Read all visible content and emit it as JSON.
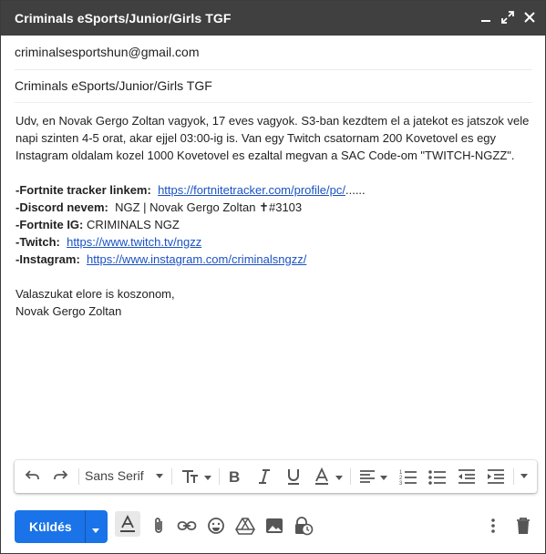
{
  "window": {
    "title": "Criminals eSports/Junior/Girls TGF"
  },
  "compose": {
    "to": "criminalsesportshun@gmail.com",
    "subject": "Criminals eSports/Junior/Girls TGF",
    "body": {
      "intro": "Udv, en Novak Gergo Zoltan vagyok, 17 eves vagyok. S3-ban kezdtem el a jatekot es jatszok vele napi szinten 4-5 orat, akar ejjel 03:00-ig is. Van egy Twitch csatornam 200 Kovetovel es egy Instagram oldalam kozel 1000 Kovetovel es ezaltal megvan a SAC Code-om \"TWITCH-NGZZ\".",
      "tracker_label": "-Fortnite tracker linkem:",
      "tracker_link": "https://fortnitetracker.com/profile/pc/",
      "tracker_suffix": "......",
      "discord_label": "-Discord nevem:",
      "discord_value": "NGZ | Novak Gergo Zoltan ✝#3103",
      "ig_label": "-Fortnite IG:",
      "ig_value": "CRIMINALS NGZ",
      "twitch_label": "-Twitch:",
      "twitch_link": "https://www.twitch.tv/ngzz",
      "instagram_label": "-Instagram:",
      "instagram_link": "https://www.instagram.com/criminalsngzz/",
      "closing": "Valaszukat elore is koszonom,",
      "signature": "Novak Gergo Zoltan"
    }
  },
  "toolbar": {
    "font": "Sans Serif"
  },
  "bottom": {
    "send_label": "Küldés"
  },
  "colors": {
    "titlebar": "#404040",
    "send": "#1a73e8",
    "link": "#1a52c4"
  }
}
